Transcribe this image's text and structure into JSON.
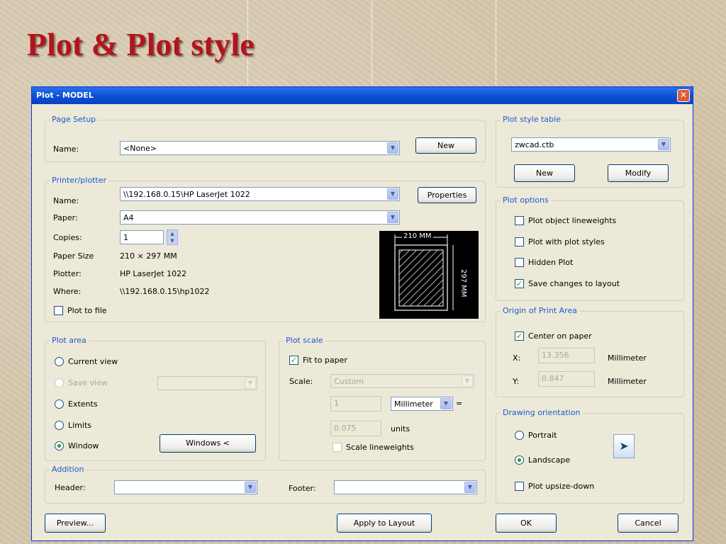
{
  "slide": {
    "title": "Plot & Plot style"
  },
  "dialog": {
    "title": "Plot - MODEL",
    "page_setup": {
      "legend": "Page Setup",
      "name_label": "Name:",
      "name_value": "<None>",
      "new_button": "New"
    },
    "printer": {
      "legend": "Printer/plotter",
      "name_label": "Name:",
      "name_value": "\\\\192.168.0.15\\HP LaserJet 1022",
      "properties_button": "Properties",
      "paper_label": "Paper:",
      "paper_value": "A4",
      "copies_label": "Copies:",
      "copies_value": "1",
      "paper_size_label": "Paper Size",
      "paper_size_value": "210 × 297  MM",
      "plotter_label": "Plotter:",
      "plotter_value": "HP LaserJet 1022",
      "where_label": "Where:",
      "where_value": "\\\\192.168.0.15\\hp1022",
      "plot_to_file_label": "Plot to file",
      "preview_width_label": "210 MM",
      "preview_height_label": "297 MM"
    },
    "plot_area": {
      "legend": "Plot area",
      "current_view": "Current view",
      "save_view": "Save view",
      "extents": "Extents",
      "limits": "Limits",
      "window": "Window",
      "window_button": "Windows <"
    },
    "plot_scale": {
      "legend": "Plot scale",
      "fit_to_paper": "Fit to paper",
      "scale_label": "Scale:",
      "scale_value": "Custom",
      "numerator": "1",
      "unit_value": "Millimeter",
      "equals": "=",
      "denominator": "0.075",
      "units_label": "units",
      "scale_lineweights": "Scale lineweights"
    },
    "addition": {
      "legend": "Addition",
      "header_label": "Header:",
      "footer_label": "Footer:"
    },
    "plot_style_table": {
      "legend": "Plot style table",
      "value": "zwcad.ctb",
      "new_button": "New",
      "modify_button": "Modify"
    },
    "plot_options": {
      "legend": "Plot options",
      "plot_object_lineweights": "Plot object lineweights",
      "plot_with_plot_styles": "Plot with plot styles",
      "hidden_plot": "Hidden Plot",
      "save_changes": "Save changes to layout"
    },
    "origin": {
      "legend": "Origin of Print Area",
      "center_on_paper": "Center on paper",
      "x_label": "X:",
      "x_value": "13.356",
      "x_unit": "Millimeter",
      "y_label": "Y:",
      "y_value": "0.847",
      "y_unit": "Millimeter"
    },
    "orientation": {
      "legend": "Drawing orientation",
      "portrait": "Portrait",
      "landscape": "Landscape",
      "upside_down": "Plot upsize-down"
    },
    "buttons": {
      "preview": "Preview...",
      "apply": "Apply to Layout",
      "ok": "OK",
      "cancel": "Cancel"
    },
    "colors": {
      "title_bar": "#0a4fd6",
      "accent_text": "#1c5bd0",
      "check": "#21a121"
    }
  }
}
